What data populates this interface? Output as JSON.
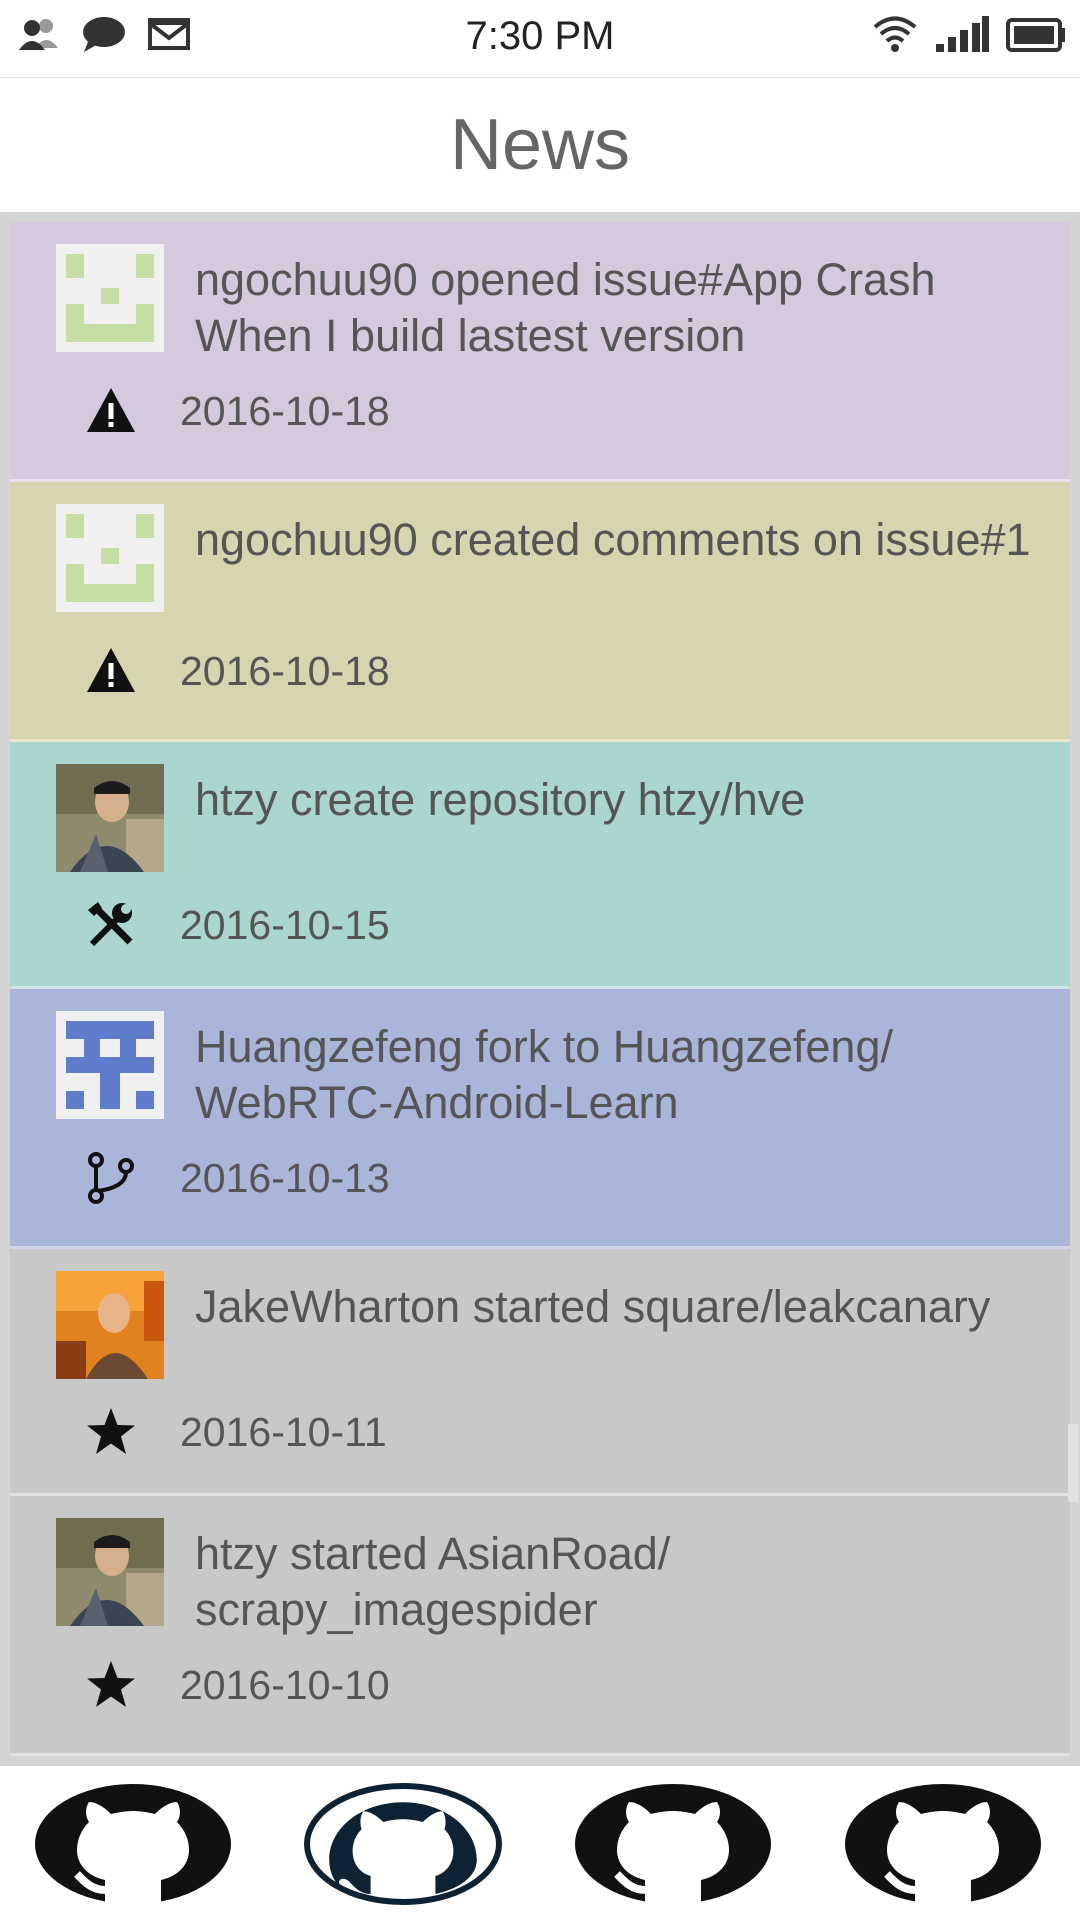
{
  "status_bar": {
    "time": "7:30 PM",
    "left_icons": [
      "contacts-icon",
      "chat-icon",
      "mail-icon"
    ],
    "right_icons": [
      "wifi-icon",
      "signal-icon",
      "battery-icon"
    ]
  },
  "header": {
    "title": "News"
  },
  "feed": [
    {
      "text": "ngochuu90 opened issue#App Crash When I build lastest version",
      "date": "2016-10-18",
      "icon": "warning-icon",
      "avatar": "identicon-green",
      "bg": "#d5c9dd"
    },
    {
      "text": "ngochuu90 created comments on issue#1",
      "date": "2016-10-18",
      "icon": "warning-icon",
      "avatar": "identicon-green",
      "bg": "#d7d4b0"
    },
    {
      "text": "htzy create repository htzy/hve",
      "date": "2016-10-15",
      "icon": "tools-icon",
      "avatar": "photo-htzy",
      "bg": "#aad6cf"
    },
    {
      "text": "Huangzefeng fork to Huangzefeng/ WebRTC-Android-Learn",
      "date": "2016-10-13",
      "icon": "fork-icon",
      "avatar": "identicon-blue",
      "bg": "#aab5da"
    },
    {
      "text": "JakeWharton started square/leakcanary",
      "date": "2016-10-11",
      "icon": "star-icon",
      "avatar": "photo-jakewharton",
      "bg": "#c8c8c8"
    },
    {
      "text": "htzy started AsianRoad/ scrapy_imagespider",
      "date": "2016-10-10",
      "icon": "star-icon",
      "avatar": "photo-htzy",
      "bg": "#c8c8c8"
    }
  ],
  "bottom_nav": {
    "tabs": [
      {
        "name": "tab-1",
        "icon": "github-octocat-icon",
        "selected": false
      },
      {
        "name": "tab-2",
        "icon": "github-octocat-icon",
        "selected": true
      },
      {
        "name": "tab-3",
        "icon": "github-octocat-icon",
        "selected": false
      },
      {
        "name": "tab-4",
        "icon": "github-octocat-icon",
        "selected": false
      }
    ],
    "selected_color": "#0d2233",
    "unselected_color": "#111111"
  }
}
